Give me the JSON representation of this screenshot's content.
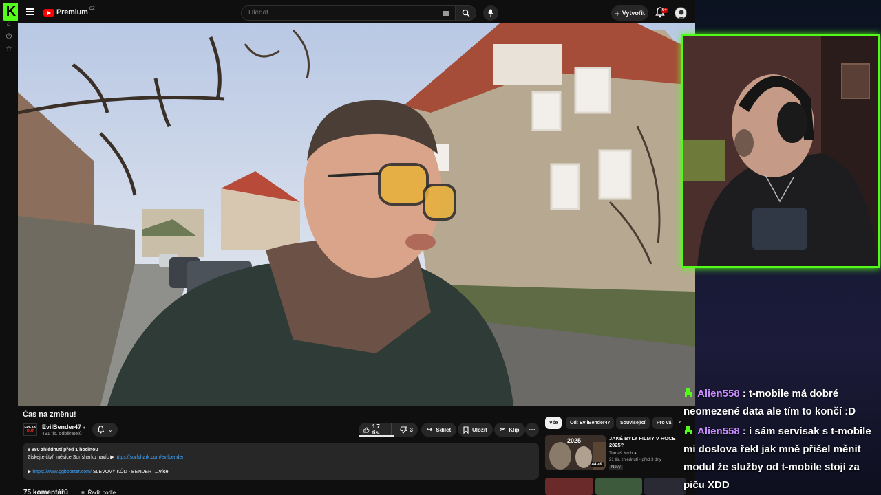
{
  "topbar": {
    "brand": "Premium",
    "region": "CZ",
    "search_placeholder": "Hledat",
    "create_label": "Vytvořit",
    "notifications_badge": "9+"
  },
  "video": {
    "title": "Čas na změnu!"
  },
  "channel": {
    "avatar_line1": "FREAK",
    "avatar_line2": "OUT",
    "name": "EvilBender47",
    "subscribers": "491 tis. odběratelů"
  },
  "actions": {
    "likes": "1,7 tis.",
    "dislikes": "3",
    "share": "Sdílet",
    "save": "Uložit",
    "clip": "Klip"
  },
  "description": {
    "stats": "8 880 zhlédnutí  před 1 hodinou",
    "promo_text": "Získejte čtyři měsíce Surfsharku navíc ▶ ",
    "promo_link": "https://surfshark.com/evilbender",
    "arrow": "▶ ",
    "booster_link": "https://www.ggbooster.com/",
    "booster_text": " SLEVOVÝ KÓD - BENDER",
    "more": "...více"
  },
  "comments": {
    "count": "75 komentářů",
    "sort_label": "Řadit podle"
  },
  "chips": [
    "Vše",
    "Od: EvilBender47",
    "Související",
    "Pro vá"
  ],
  "recommended": {
    "year": "2025",
    "duration": "44:49",
    "title": "JAKÉ BYLY FILMY V ROCE 2025?",
    "channel": "Tomáš Krch",
    "meta": "21 tis. zhlédnutí • před 3 dny",
    "badge": "Nový"
  },
  "chat": [
    {
      "user": "Alien558",
      "message": " : t-mobile má dobré neomezené data ale tím to končí :D"
    },
    {
      "user": "Alien558",
      "message": " : i sám servisak s t-mobile mi doslova řekl jak mně přišel měnit modul že služby od t-mobile stojí za piču XDD"
    }
  ],
  "colors": {
    "kick_green": "#53fc18",
    "yt_red": "#ff0000",
    "chat_username": "#c78cff",
    "link_blue": "#3ea6ff"
  }
}
